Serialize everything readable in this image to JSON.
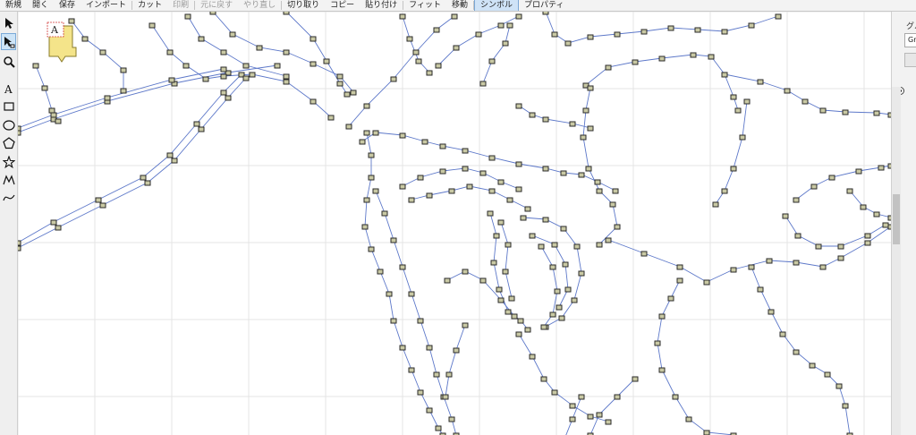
{
  "toolbar": {
    "items": [
      {
        "label": "新規",
        "state": "normal"
      },
      {
        "label": "開く",
        "state": "normal"
      },
      {
        "label": "保存",
        "state": "normal"
      },
      {
        "label": "インポート",
        "state": "normal"
      },
      {
        "label": "カット",
        "state": "normal"
      },
      {
        "label": "印刷",
        "state": "disabled"
      },
      {
        "label": "元に戻す",
        "state": "disabled"
      },
      {
        "label": "やり直し",
        "state": "disabled"
      },
      {
        "label": "切り取り",
        "state": "normal"
      },
      {
        "label": "コピー",
        "state": "normal"
      },
      {
        "label": "貼り付け",
        "state": "normal"
      },
      {
        "label": "フィット",
        "state": "normal"
      },
      {
        "label": "移動",
        "state": "normal"
      },
      {
        "label": "シンボル",
        "state": "active"
      },
      {
        "label": "プロパティ",
        "state": "normal"
      }
    ]
  },
  "tools": [
    {
      "name": "select-arrow-tool",
      "icon": "arrow-pointer-icon",
      "selected": false
    },
    {
      "name": "node-edit-tool",
      "icon": "node-arrow-icon",
      "selected": true
    },
    {
      "name": "zoom-tool",
      "icon": "magnifier-icon",
      "selected": false
    },
    {
      "name": "text-tool",
      "icon": "text-a-icon",
      "selected": false
    },
    {
      "name": "rectangle-tool",
      "icon": "rectangle-icon",
      "selected": false
    },
    {
      "name": "ellipse-tool",
      "icon": "ellipse-icon",
      "selected": false
    },
    {
      "name": "polygon-tool",
      "icon": "pentagon-icon",
      "selected": false
    },
    {
      "name": "star-tool",
      "icon": "star-icon",
      "selected": false
    },
    {
      "name": "polyline-tool",
      "icon": "polyline-icon",
      "selected": false
    },
    {
      "name": "curve-tool",
      "icon": "curve-icon",
      "selected": false
    }
  ],
  "right_panel": {
    "title": "グル",
    "field_value": "Gr"
  },
  "symbol_stamp": {
    "letter": "A"
  },
  "colors": {
    "path": "#5d78c9",
    "node_fill": "#c9c9a4",
    "node_stroke": "#2a2a2a",
    "grid": "#e4e4e4",
    "active_tab": "#cfe3f7"
  }
}
